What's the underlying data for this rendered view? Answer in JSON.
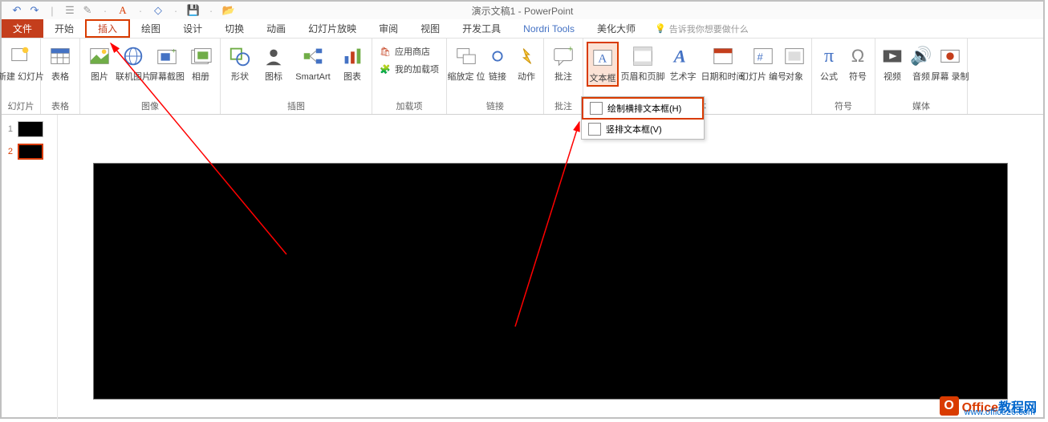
{
  "title": "演示文稿1 - PowerPoint",
  "tabs": {
    "file": "文件",
    "home": "开始",
    "insert": "插入",
    "draw": "绘图",
    "design": "设计",
    "transitions": "切换",
    "animations": "动画",
    "slideshow": "幻灯片放映",
    "review": "审阅",
    "view": "视图",
    "developer": "开发工具",
    "nordri": "Nordri Tools",
    "beautify": "美化大师",
    "tell": "告诉我你想要做什么"
  },
  "groups": {
    "slides": "幻灯片",
    "tables": "表格",
    "images": "图像",
    "illustrations": "插图",
    "addins": "加载项",
    "links": "链接",
    "comments": "批注",
    "text": "文本",
    "symbols": "符号",
    "media": "媒体"
  },
  "commands": {
    "new_slide": "新建\n幻灯片",
    "table": "表格",
    "pictures": "图片",
    "online_pictures": "联机图片",
    "screenshot": "屏幕截图",
    "photo_album": "相册",
    "shapes": "形状",
    "icons": "图标",
    "smartart": "SmartArt",
    "chart": "图表",
    "store": "应用商店",
    "my_addins": "我的加载项",
    "zoom": "缩放定\n位",
    "link": "链接",
    "action": "动作",
    "comment": "批注",
    "text_box": "文本框",
    "header_footer": "页眉和页脚",
    "wordart": "艺术字",
    "date_time": "日期和时间",
    "slide_number": "幻灯片\n编号",
    "object": "对象",
    "equation": "公式",
    "symbol": "符号",
    "video": "视频",
    "audio": "音频",
    "screen_recording": "屏幕\n录制"
  },
  "dropdown": {
    "horizontal": "绘制横排文本框(H)",
    "vertical": "竖排文本框(V)"
  },
  "thumbnails": [
    {
      "num": "1",
      "selected": false
    },
    {
      "num": "2",
      "selected": true
    }
  ],
  "watermark": {
    "brand1": "Office",
    "brand2": "教程网",
    "url": "www.office26.com"
  }
}
